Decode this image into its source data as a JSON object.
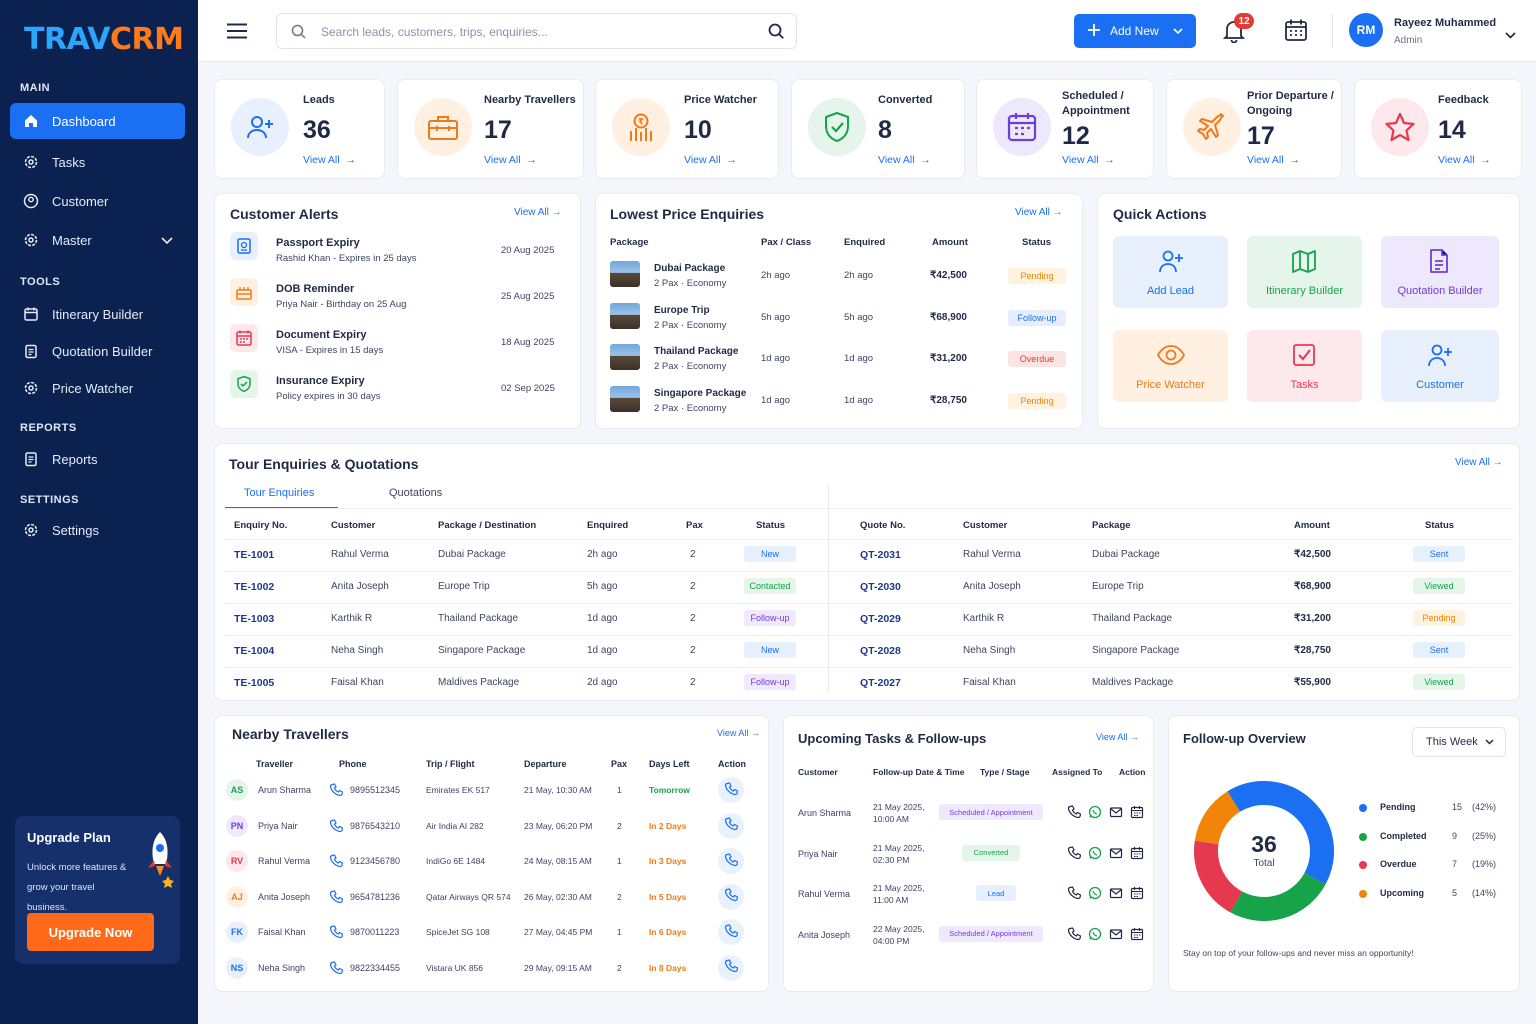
{
  "brand": {
    "part1": "TRAV",
    "part2": "CRM"
  },
  "sidebar": {
    "main_label": "MAIN",
    "tools_label": "TOOLS",
    "reports_label": "REPORTS",
    "settings_label": "SETTINGS",
    "items": [
      {
        "label": "Dashboard",
        "icon": "home-icon"
      },
      {
        "label": "Tasks",
        "icon": "gear-icon"
      },
      {
        "label": "Customer",
        "icon": "user-circle-icon"
      },
      {
        "label": "Master",
        "icon": "gear-icon"
      },
      {
        "label": "Itinerary Builder",
        "icon": "calendar-icon"
      },
      {
        "label": "Quotation Builder",
        "icon": "clipboard-icon"
      },
      {
        "label": "Price Watcher",
        "icon": "gear-icon"
      },
      {
        "label": "Reports",
        "icon": "document-icon"
      },
      {
        "label": "Settings",
        "icon": "gear-icon"
      }
    ],
    "upgrade": {
      "title": "Upgrade Plan",
      "desc": "Unlock more features & grow your travel business.",
      "button": "Upgrade Now"
    }
  },
  "topbar": {
    "search_placeholder": "Search leads, customers, trips, enquiries...",
    "add_new": "Add New",
    "notif_count": "12",
    "user_initials": "RM",
    "user_name": "Rayeez Muhammed",
    "user_role": "Admin"
  },
  "stats": [
    {
      "label": "Leads",
      "value": "36",
      "link": "View All",
      "color": "#1b6ff2",
      "bg": "#e8f0fe",
      "icon": "user-plus-icon"
    },
    {
      "label": "Nearby Travellers",
      "value": "17",
      "link": "View All",
      "color": "#f07a1a",
      "bg": "#fff0e2",
      "icon": "luggage-icon"
    },
    {
      "label": "Price Watcher",
      "value": "10",
      "link": "View All",
      "color": "#f07a1a",
      "bg": "#fff0e2",
      "icon": "price-icon"
    },
    {
      "label": "Converted",
      "value": "8",
      "link": "View All",
      "color": "#16a34a",
      "bg": "#e5f5eb",
      "icon": "shield-check-icon"
    },
    {
      "label": "Scheduled / Appointment",
      "value": "12",
      "link": "View All",
      "color": "#6b3fd9",
      "bg": "#eee8fc",
      "icon": "calendar-icon"
    },
    {
      "label": "Prior Departure / Ongoing",
      "value": "17",
      "link": "View All",
      "color": "#f07a1a",
      "bg": "#fff0e2",
      "icon": "plane-icon"
    },
    {
      "label": "Feedback",
      "value": "14",
      "link": "View All",
      "color": "#e53950",
      "bg": "#fde8ec",
      "icon": "star-icon"
    }
  ],
  "alerts": {
    "title": "Customer Alerts",
    "view_all": "View All",
    "items": [
      {
        "title": "Passport Expiry",
        "sub": "Rashid Khan - Expires in 25 days",
        "date": "20 Aug 2025",
        "color": "#1b6ff2",
        "bg": "#e8f0fe"
      },
      {
        "title": "DOB Reminder",
        "sub": "Priya Nair - Birthday on 25 Aug",
        "date": "25 Aug 2025",
        "color": "#f07a1a",
        "bg": "#fff0e2"
      },
      {
        "title": "Document Expiry",
        "sub": "VISA - Expires in 15 days",
        "date": "18 Aug 2025",
        "color": "#e53950",
        "bg": "#fde8ec"
      },
      {
        "title": "Insurance Expiry",
        "sub": "Policy expires in 30 days",
        "date": "02 Sep 2025",
        "color": "#16a34a",
        "bg": "#e5f5eb"
      }
    ]
  },
  "lowest": {
    "title": "Lowest Price Enquiries",
    "view_all": "View All",
    "headers": [
      "Package",
      "Pax / Class",
      "Enquired",
      "Amount",
      "Status"
    ],
    "rows": [
      {
        "pkg": "Dubai Package",
        "sub": "2 Pax · Economy",
        "pax": "2h ago",
        "enq": "2h ago",
        "amt": "₹42,500",
        "status": "Pending",
        "cls": "b-pending"
      },
      {
        "pkg": "Europe Trip",
        "sub": "2 Pax · Economy",
        "pax": "5h ago",
        "enq": "5h ago",
        "amt": "₹68,900",
        "status": "Follow-up",
        "cls": "b-follow"
      },
      {
        "pkg": "Thailand Package",
        "sub": "2 Pax · Economy",
        "pax": "1d ago",
        "enq": "1d ago",
        "amt": "₹31,200",
        "status": "Overdue",
        "cls": "b-overdue"
      },
      {
        "pkg": "Singapore Package",
        "sub": "2 Pax · Economy",
        "pax": "1d ago",
        "enq": "1d ago",
        "amt": "₹28,750",
        "status": "Pending",
        "cls": "b-pending"
      }
    ]
  },
  "quick": {
    "title": "Quick Actions",
    "items": [
      {
        "label": "Add Lead",
        "color": "#1b6ff2",
        "bg": "#e8f0fe",
        "icon": "user-plus-icon"
      },
      {
        "label": "Itinerary Builder",
        "color": "#16a34a",
        "bg": "#e5f5eb",
        "icon": "map-icon"
      },
      {
        "label": "Quotation Builder",
        "color": "#6b3fd9",
        "bg": "#eee8fc",
        "icon": "document-icon"
      },
      {
        "label": "Price Watcher",
        "color": "#f07a1a",
        "bg": "#fff0e2",
        "icon": "eye-icon"
      },
      {
        "label": "Tasks",
        "color": "#e53950",
        "bg": "#fde8ec",
        "icon": "checkbox-icon"
      },
      {
        "label": "Customer",
        "color": "#1b6ff2",
        "bg": "#e8f0fe",
        "icon": "user-plus-icon"
      }
    ]
  },
  "tour": {
    "title": "Tour Enquiries  &  Quotations",
    "view_all": "View All",
    "tab1": "Tour Enquiries",
    "tab2": "Quotations",
    "enq_headers": [
      "Enquiry No.",
      "Customer",
      "Package / Destination",
      "Enquired",
      "Pax",
      "Status"
    ],
    "enq_rows": [
      {
        "no": "TE-1001",
        "cust": "Rahul Verma",
        "pkg": "Dubai Package",
        "enq": "2h ago",
        "pax": "2",
        "status": "New",
        "cls": "b-new"
      },
      {
        "no": "TE-1002",
        "cust": "Anita Joseph",
        "pkg": "Europe Trip",
        "enq": "5h ago",
        "pax": "2",
        "status": "Contacted",
        "cls": "b-contacted"
      },
      {
        "no": "TE-1003",
        "cust": "Karthik R",
        "pkg": "Thailand Package",
        "enq": "1d ago",
        "pax": "2",
        "status": "Follow-up",
        "cls": "b-fup"
      },
      {
        "no": "TE-1004",
        "cust": "Neha Singh",
        "pkg": "Singapore Package",
        "enq": "1d ago",
        "pax": "2",
        "status": "New",
        "cls": "b-new"
      },
      {
        "no": "TE-1005",
        "cust": "Faisal Khan",
        "pkg": "Maldives Package",
        "enq": "2d ago",
        "pax": "2",
        "status": "Follow-up",
        "cls": "b-fup"
      }
    ],
    "q_headers": [
      "Quote No.",
      "Customer",
      "Package",
      "Amount",
      "Status"
    ],
    "q_rows": [
      {
        "no": "QT-2031",
        "cust": "Rahul Verma",
        "pkg": "Dubai Package",
        "amt": "₹42,500",
        "status": "Sent",
        "cls": "b-sent"
      },
      {
        "no": "QT-2030",
        "cust": "Anita Joseph",
        "pkg": "Europe Trip",
        "amt": "₹68,900",
        "status": "Viewed",
        "cls": "b-viewed"
      },
      {
        "no": "QT-2029",
        "cust": "Karthik R",
        "pkg": "Thailand Package",
        "amt": "₹31,200",
        "status": "Pending",
        "cls": "b-pending"
      },
      {
        "no": "QT-2028",
        "cust": "Neha Singh",
        "pkg": "Singapore Package",
        "amt": "₹28,750",
        "status": "Sent",
        "cls": "b-sent"
      },
      {
        "no": "QT-2027",
        "cust": "Faisal Khan",
        "pkg": "Maldives Package",
        "amt": "₹55,900",
        "status": "Viewed",
        "cls": "b-viewed"
      }
    ]
  },
  "nearby": {
    "title": "Nearby Travellers",
    "view_all": "View All",
    "headers": [
      "Traveller",
      "Phone",
      "Trip / Flight",
      "Departure",
      "Pax",
      "Days Left",
      "Action"
    ],
    "rows": [
      {
        "ini": "AS",
        "name": "Arun Sharma",
        "phone": "9895512345",
        "trip": "Emirates EK 517",
        "dep": "21 May, 10:30 AM",
        "pax": "1",
        "days": "Tomorrow",
        "dc": "#16a34a",
        "ac": "#16a34a",
        "ab": "#e5f5eb"
      },
      {
        "ini": "PN",
        "name": "Priya Nair",
        "phone": "9876543210",
        "trip": "Air India AI 282",
        "dep": "23 May, 06:20 PM",
        "pax": "2",
        "days": "In 2 Days",
        "dc": "#f07a1a",
        "ac": "#6b3fd9",
        "ab": "#eee8fc"
      },
      {
        "ini": "RV",
        "name": "Rahul Verma",
        "phone": "9123456780",
        "trip": "IndiGo 6E 1484",
        "dep": "24 May, 08:15 AM",
        "pax": "1",
        "days": "In 3 Days",
        "dc": "#f07a1a",
        "ac": "#e53950",
        "ab": "#fde8ec"
      },
      {
        "ini": "AJ",
        "name": "Anita Joseph",
        "phone": "9654781236",
        "trip": "Qatar Airways QR 574",
        "dep": "26 May, 02:30 AM",
        "pax": "2",
        "days": "In 5 Days",
        "dc": "#f07a1a",
        "ac": "#f07a1a",
        "ab": "#fff0e2"
      },
      {
        "ini": "FK",
        "name": "Faisal Khan",
        "phone": "9870011223",
        "trip": "SpiceJet SG 108",
        "dep": "27 May, 04:45 PM",
        "pax": "1",
        "days": "In 6 Days",
        "dc": "#f07a1a",
        "ac": "#1b6ff2",
        "ab": "#e8f0fe"
      },
      {
        "ini": "NS",
        "name": "Neha Singh",
        "phone": "9822334455",
        "trip": "Vistara UK 856",
        "dep": "29 May, 09:15 AM",
        "pax": "2",
        "days": "In 8 Days",
        "dc": "#f07a1a",
        "ac": "#1b6ff2",
        "ab": "#e8f0fe"
      }
    ]
  },
  "tasks": {
    "title": "Upcoming Tasks & Follow-ups",
    "view_all": "View All",
    "headers": [
      "Customer",
      "Follow-up Date & Time",
      "Type / Stage",
      "Assigned To",
      "Action"
    ],
    "rows": [
      {
        "cust": "Arun Sharma",
        "d1": "21 May 2025,",
        "d2": "10:00 AM",
        "type": "Scheduled / Appointment",
        "cls": "b-sched"
      },
      {
        "cust": "Priya Nair",
        "d1": "21 May 2025,",
        "d2": "02:30 PM",
        "type": "Converted",
        "cls": "b-conv"
      },
      {
        "cust": "Rahul Verma",
        "d1": "21 May 2025,",
        "d2": "11:00 AM",
        "type": "Lead",
        "cls": "b-lead"
      },
      {
        "cust": "Anita Joseph",
        "d1": "22 May 2025,",
        "d2": "04:00 PM",
        "type": "Scheduled / Appointment",
        "cls": "b-sched"
      }
    ]
  },
  "followup": {
    "title": "Follow-up Overview",
    "period": "This Week",
    "total": "36",
    "total_label": "Total",
    "footer": "Stay on top of your follow-ups and never miss an opportunity!"
  },
  "chart_data": {
    "type": "pie",
    "series": [
      {
        "name": "Pending",
        "value": 15,
        "pct": "(42%)",
        "color": "#1b6ff2"
      },
      {
        "name": "Completed",
        "value": 9,
        "pct": "(25%)",
        "color": "#16a34a"
      },
      {
        "name": "Overdue",
        "value": 7,
        "pct": "(19%)",
        "color": "#e53950"
      },
      {
        "name": "Upcoming",
        "value": 5,
        "pct": "(14%)",
        "color": "#f0850a"
      }
    ]
  }
}
